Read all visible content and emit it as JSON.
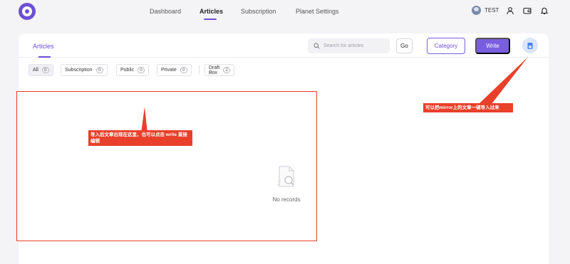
{
  "nav": {
    "items": [
      "Dashboard",
      "Articles",
      "Subscription",
      "Planet Settings"
    ],
    "active": "Articles",
    "user_name": "TEST"
  },
  "header": {
    "tab": "Articles",
    "search_placeholder": "Search for articles",
    "go_label": "Go",
    "category_label": "Category",
    "write_label": "Write"
  },
  "filters": [
    {
      "label": "All",
      "count": "0"
    },
    {
      "label": "Subscription",
      "count": "0"
    },
    {
      "label": "Public",
      "count": "0"
    },
    {
      "label": "Private",
      "count": "0"
    },
    {
      "label": "Draft Box",
      "count": "2"
    }
  ],
  "empty_text": "No records",
  "annotations": {
    "note_list": "导入后文章出现在这里，也可以点击 write 直接编辑",
    "note_import": "可以把mirror上的文章一键导入过来"
  },
  "colors": {
    "accent": "#6c4fd8",
    "annotation": "#e8402a"
  }
}
